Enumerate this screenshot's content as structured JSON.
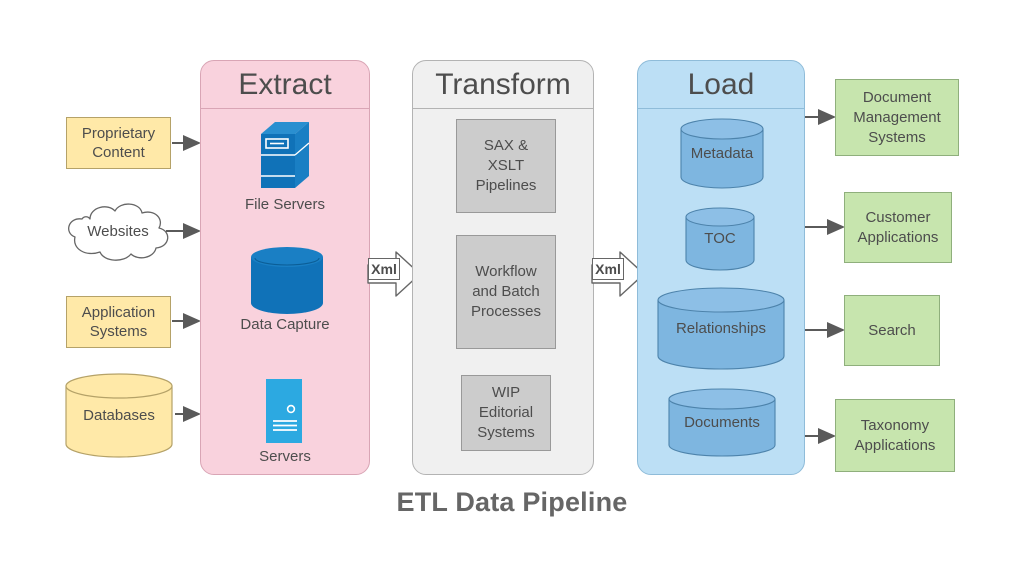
{
  "title": "ETL Data Pipeline",
  "sources": [
    {
      "name": "proprietary-content",
      "label": "Proprietary\nContent",
      "shape": "rect"
    },
    {
      "name": "websites",
      "label": "Websites",
      "shape": "cloud"
    },
    {
      "name": "application-systems",
      "label": "Application\nSystems",
      "shape": "rect"
    },
    {
      "name": "databases",
      "label": "Databases",
      "shape": "cylinder"
    }
  ],
  "stages": [
    {
      "name": "extract",
      "header": "Extract",
      "color": "#f9d2dd",
      "border": "#d9a5b5",
      "items": [
        {
          "name": "file-servers",
          "label": "File Servers",
          "icon": "server-cabinet-icon"
        },
        {
          "name": "data-capture",
          "label": "Data Capture",
          "icon": "database-cylinder-icon"
        },
        {
          "name": "servers",
          "label": "Servers",
          "icon": "rack-server-icon"
        }
      ]
    },
    {
      "name": "transform",
      "header": "Transform",
      "color": "#f0f0f0",
      "border": "#b3b3b3",
      "items": [
        {
          "name": "sax-xslt-pipelines",
          "label": "SAX &\nXSLT\nPipelines"
        },
        {
          "name": "workflow-and-batch-processes",
          "label": "Workflow\nand Batch\nProcesses"
        },
        {
          "name": "wip-editorial-systems",
          "label": "WIP\nEditorial\nSystems"
        }
      ]
    },
    {
      "name": "load",
      "header": "Load",
      "color": "#bcdff5",
      "border": "#8fbcd9",
      "items": [
        {
          "name": "metadata",
          "label": "Metadata"
        },
        {
          "name": "toc",
          "label": "TOC"
        },
        {
          "name": "relationships",
          "label": "Relationships"
        },
        {
          "name": "documents",
          "label": "Documents"
        }
      ]
    }
  ],
  "connectors": [
    {
      "name": "xml-connector-extract-transform",
      "label": "Xml"
    },
    {
      "name": "xml-connector-transform-load",
      "label": "Xml"
    }
  ],
  "outputs": [
    {
      "name": "document-management-systems",
      "label": "Document\nManagement\nSystems"
    },
    {
      "name": "customer-applications",
      "label": "Customer\nApplications"
    },
    {
      "name": "search",
      "label": "Search"
    },
    {
      "name": "taxonomy-applications",
      "label": "Taxonomy\nApplications"
    }
  ],
  "colors": {
    "source_fill": "#ffe9a8",
    "extract_fill": "#f9d2dd",
    "transform_fill": "#f0f0f0",
    "load_fill": "#bcdff5",
    "output_fill": "#c7e5ae",
    "icon_blue_dark": "#1072b8",
    "icon_blue_light": "#2ca9e1",
    "cylinder_blue": "#7eb6e0",
    "text": "#4d4d4d"
  }
}
